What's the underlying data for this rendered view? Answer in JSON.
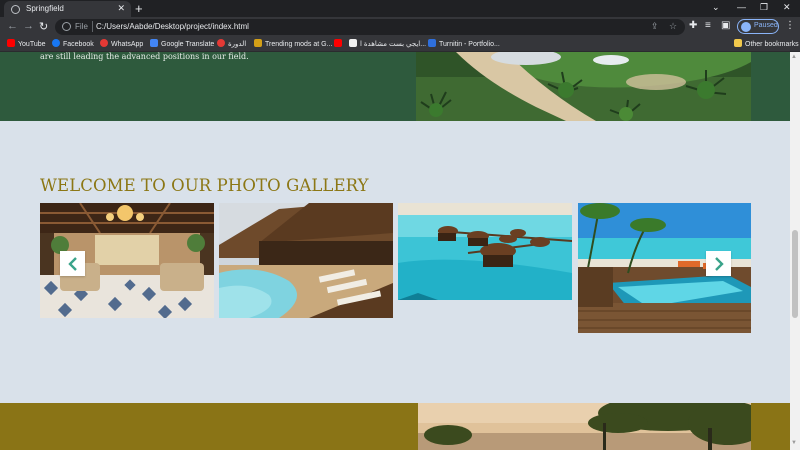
{
  "browser": {
    "tab_title": "Springfield",
    "tab_close": "✕",
    "new_tab": "+",
    "window_controls": [
      "⌄",
      "—",
      "❐",
      "✕"
    ],
    "back": "←",
    "forward": "→",
    "reload": "↻",
    "scheme_label": "File",
    "url": "C:/Users/Aabde/Desktop/project/index.html",
    "profile_label": "Paused",
    "bookmarks": [
      {
        "label": "YouTube",
        "color": "#ff0000"
      },
      {
        "label": "Facebook",
        "color": "#1877f2"
      },
      {
        "label": "WhatsApp",
        "color": "#e53935"
      },
      {
        "label": "Google Translate",
        "color": "#4285f4"
      },
      {
        "label": "الدورة",
        "color": "#e53935"
      },
      {
        "label": "Trending mods at G...",
        "color": "#d4a017"
      },
      {
        "label": "",
        "color": "#ff0000"
      },
      {
        "label": "ايجي بست مشاهدة ا...",
        "color": "#f1f1f1"
      },
      {
        "label": "Turnitin - Portfolio...",
        "color": "#2f6fdc"
      }
    ],
    "other_bookmarks": "Other bookmarks"
  },
  "page": {
    "top_section": {
      "text": "are still leading the advanced positions in our field."
    },
    "gallery": {
      "title": "WELCOME TO OUR PHOTO GALLERY",
      "prev_icon": "chevron-left-icon",
      "next_icon": "chevron-right-icon",
      "photos": [
        {
          "subject": "hotel-lobby"
        },
        {
          "subject": "pool-resort"
        },
        {
          "subject": "overwater-bungalows"
        },
        {
          "subject": "infinity-pool-deck"
        }
      ]
    }
  },
  "colors": {
    "green_section": "#2e5a3d",
    "gallery_bg": "#d9e1ea",
    "title_gold": "#8c7715",
    "gold_section": "#8a7416",
    "arrow_color": "#3aa38a"
  }
}
